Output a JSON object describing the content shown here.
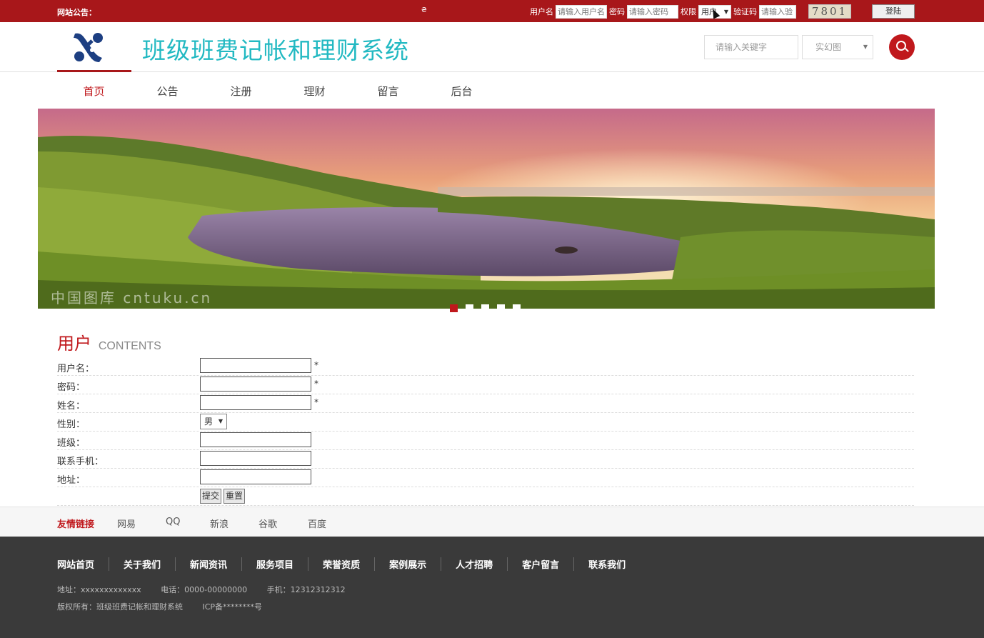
{
  "topbar": {
    "notice_label": "网站公告：",
    "marquee_char": "₴",
    "username_label": "用户名",
    "username_placeholder": "请输入用户名",
    "password_label": "密码",
    "password_placeholder": "请输入密码",
    "role_label": "权限",
    "role_value": "用户",
    "captcha_label": "验证码",
    "captcha_placeholder": "请输入验",
    "captcha_code": "7801",
    "login_button": "登陆"
  },
  "header": {
    "site_title": "班级班费记帐和理财系统",
    "search_placeholder": "请输入关键字",
    "search_select_value": "实幻图"
  },
  "nav": {
    "items": [
      {
        "label": "首页",
        "active": true
      },
      {
        "label": "公告",
        "active": false
      },
      {
        "label": "注册",
        "active": false
      },
      {
        "label": "理财",
        "active": false
      },
      {
        "label": "留言",
        "active": false
      },
      {
        "label": "后台",
        "active": false
      }
    ]
  },
  "banner": {
    "watermark": "中国图库 cntuku.cn",
    "slide_count": 5,
    "active_slide": 1
  },
  "form": {
    "title_zh": "用户",
    "title_en": "CONTENTS",
    "fields": [
      {
        "label": "用户名：",
        "required": "*"
      },
      {
        "label": "密码：",
        "required": "*"
      },
      {
        "label": "姓名：",
        "required": "*"
      },
      {
        "label": "性别：",
        "value": "男"
      },
      {
        "label": "班级："
      },
      {
        "label": "联系手机："
      },
      {
        "label": "地址："
      }
    ],
    "submit_label": "提交",
    "reset_label": "重置"
  },
  "links": {
    "title": "友情链接",
    "items": [
      "网易",
      "QQ",
      "新浪",
      "谷歌",
      "百度"
    ]
  },
  "footer": {
    "nav": [
      "网站首页",
      "关于我们",
      "新闻资讯",
      "服务项目",
      "荣誉资质",
      "案例展示",
      "人才招聘",
      "客户留言",
      "联系我们"
    ],
    "address": "地址：xxxxxxxxxxxxx",
    "phone": "电话：0000-00000000",
    "mobile": "手机：12312312312",
    "copyright": "版权所有：班级班费记帐和理财系统",
    "icp": "ICP备********号"
  },
  "colors": {
    "brand_red": "#a8171a",
    "title_cyan": "#22b9c2",
    "footer_bg": "#3a3a3a"
  }
}
